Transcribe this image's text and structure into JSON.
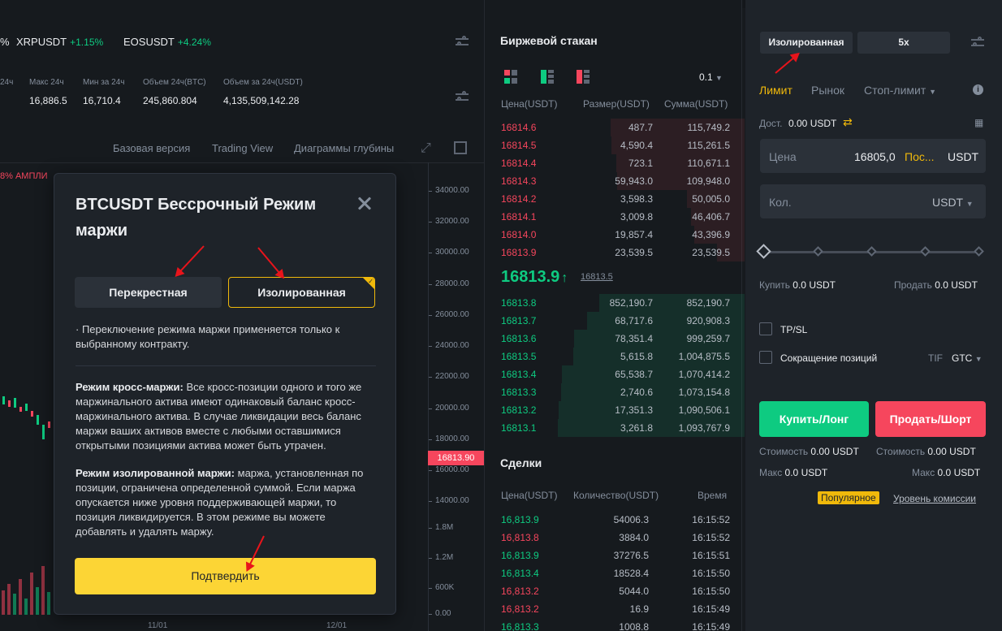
{
  "tickers": [
    {
      "symbol": "%",
      "change": ""
    },
    {
      "symbol": "XRPUSDT",
      "change": "+1.15%"
    },
    {
      "symbol": "EOSUSDT",
      "change": "+4.24%"
    }
  ],
  "stats": [
    {
      "label": "24ч",
      "value": ""
    },
    {
      "label": "Макс 24ч",
      "value": "16,886.5"
    },
    {
      "label": "Мин за 24ч",
      "value": "16,710.4"
    },
    {
      "label": "Объем 24ч(BTC)",
      "value": "245,860.804"
    },
    {
      "label": "Объем за 24ч(USDT)",
      "value": "4,135,509,142.28"
    }
  ],
  "chart_nav": {
    "basic": "Базовая версия",
    "tradingview": "Trading View",
    "depth": "Диаграммы глубины"
  },
  "chart_indicator": "8% АМПЛИ",
  "y_axis": [
    "34000.00",
    "32000.00",
    "30000.00",
    "28000.00",
    "26000.00",
    "24000.00",
    "22000.00",
    "20000.00",
    "18000.00",
    "16000.00",
    "14000.00",
    "1.8M",
    "1.2M",
    "600K",
    "0.00"
  ],
  "chart_price_tag": "16813.90",
  "x_axis": [
    "11/01",
    "12/01"
  ],
  "order_book": {
    "title": "Биржевой стакан",
    "precision": "0.1",
    "headers": [
      "Цена(USDT)",
      "Размер(USDT)",
      "Сумма(USDT)"
    ],
    "asks": [
      [
        "16814.6",
        "487.7",
        "115,749.2"
      ],
      [
        "16814.5",
        "4,590.4",
        "115,261.5"
      ],
      [
        "16814.4",
        "723.1",
        "110,671.1"
      ],
      [
        "16814.3",
        "59,943.0",
        "109,948.0"
      ],
      [
        "16814.2",
        "3,598.3",
        "50,005.0"
      ],
      [
        "16814.1",
        "3,009.8",
        "46,406.7"
      ],
      [
        "16814.0",
        "19,857.4",
        "43,396.9"
      ],
      [
        "16813.9",
        "23,539.5",
        "23,539.5"
      ]
    ],
    "last_price": "16813.9",
    "last_arrow": "↑",
    "mark_price": "16813.5",
    "bids": [
      [
        "16813.8",
        "852,190.7",
        "852,190.7"
      ],
      [
        "16813.7",
        "68,717.6",
        "920,908.3"
      ],
      [
        "16813.6",
        "78,351.4",
        "999,259.7"
      ],
      [
        "16813.5",
        "5,615.8",
        "1,004,875.5"
      ],
      [
        "16813.4",
        "65,538.7",
        "1,070,414.2"
      ],
      [
        "16813.3",
        "2,740.6",
        "1,073,154.8"
      ],
      [
        "16813.2",
        "17,351.3",
        "1,090,506.1"
      ],
      [
        "16813.1",
        "3,261.8",
        "1,093,767.9"
      ]
    ]
  },
  "trades": {
    "title": "Сделки",
    "headers": [
      "Цена(USDT)",
      "Количество(USDT)",
      "Время"
    ],
    "rows": [
      {
        "price": "16,813.9",
        "qty": "54006.3",
        "time": "16:15:52",
        "side": "buy"
      },
      {
        "price": "16,813.8",
        "qty": "3884.0",
        "time": "16:15:52",
        "side": "sell"
      },
      {
        "price": "16,813.9",
        "qty": "37276.5",
        "time": "16:15:51",
        "side": "buy"
      },
      {
        "price": "16,813.4",
        "qty": "18528.4",
        "time": "16:15:50",
        "side": "buy"
      },
      {
        "price": "16,813.2",
        "qty": "5044.0",
        "time": "16:15:50",
        "side": "sell"
      },
      {
        "price": "16,813.2",
        "qty": "16.9",
        "time": "16:15:49",
        "side": "sell"
      },
      {
        "price": "16,813.3",
        "qty": "1008.8",
        "time": "16:15:49",
        "side": "buy"
      }
    ]
  },
  "trade_panel": {
    "margin_mode": "Изолированная",
    "leverage": "5x",
    "tabs": [
      "Лимит",
      "Рынок",
      "Стоп-лимит"
    ],
    "available_label": "Дост.",
    "available_value": "0.00 USDT",
    "price_label": "Цена",
    "price_value": "16805,0",
    "price_suffix": "Пос...",
    "price_currency": "USDT",
    "qty_label": "Кол.",
    "qty_currency": "USDT",
    "buy_label": "Купить",
    "buy_value": "0.0 USDT",
    "sell_label": "Продать",
    "sell_value": "0.0 USDT",
    "tpsl": "TP/SL",
    "reduce_only": "Сокращение позиций",
    "tif_label": "TIF",
    "tif_value": "GTC",
    "buy_btn": "Купить/Лонг",
    "sell_btn": "Продать/Шорт",
    "cost_label": "Стоимость",
    "cost_value": "0.00 USDT",
    "max_label": "Макс",
    "max_value": "0.0 USDT",
    "popular_badge": "Популярное",
    "fee_link": "Уровень комиссии"
  },
  "modal": {
    "title": "BTCUSDT Бессрочный Режим маржи",
    "cross_label": "Перекрестная",
    "isolated_label": "Изолированная",
    "note": "· Переключение режима маржи применяется только к выбранному контракту.",
    "cross_title": "Режим кросс-маржи:",
    "cross_text": " Все кросс-позиции одного и того же маржинального актива имеют одинаковый баланс кросс-маржинального актива. В случае ликвидации весь баланс маржи ваших активов вместе с любыми оставшимися открытыми позициями актива может быть утрачен.",
    "iso_title": "Режим изолированной маржи:",
    "iso_text": " маржа, установленная по позиции, ограничена определенной суммой. Если маржа опускается ниже уровня поддерживающей маржи, то позиция ликвидируется. В этом режиме вы можете добавлять и удалять маржу.",
    "confirm": "Подтвердить"
  },
  "colors": {
    "accent": "#f0b90b",
    "buy": "#0ecb81",
    "sell": "#f6465d",
    "annotation": "#e8141b"
  }
}
